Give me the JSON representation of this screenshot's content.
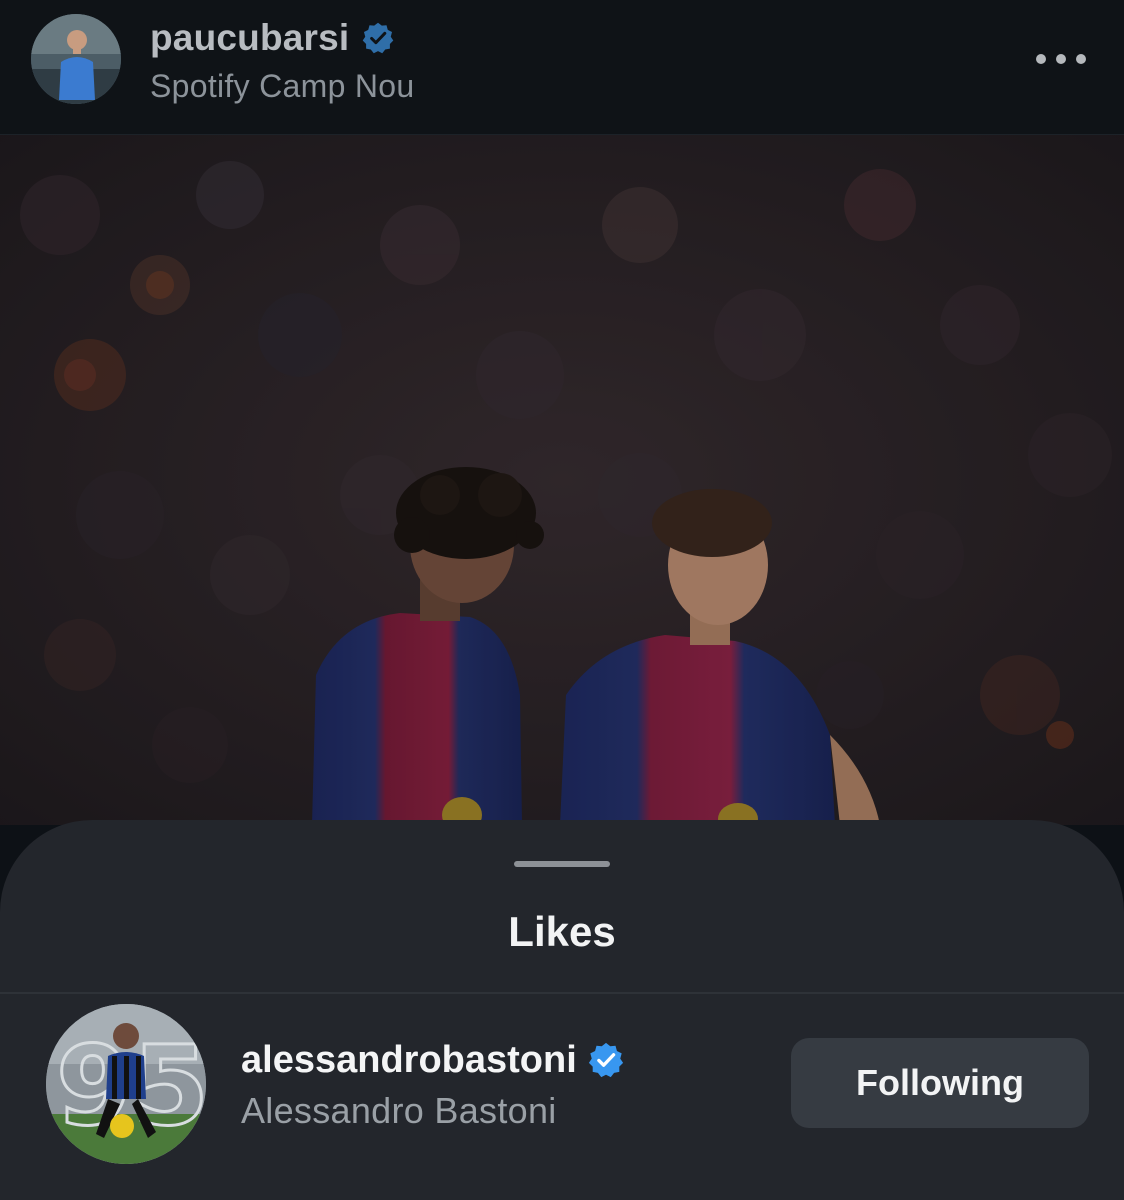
{
  "post": {
    "username": "paucubarsi",
    "location": "Spotify Camp Nou",
    "avatar_icon": "profile-photo-player",
    "verified_icon": "verified-badge-icon",
    "more_icon": "more-horizontal-icon"
  },
  "likes_sheet": {
    "title": "Likes",
    "users": [
      {
        "username": "alessandrobastoni",
        "full_name": "Alessandro Bastoni",
        "verified": true,
        "button_label": "Following"
      }
    ]
  },
  "colors": {
    "background": "#0d1116",
    "sheet": "#23262c",
    "button": "#363b42",
    "verified": "#3897f0",
    "barca_blue": "#1d2b6e",
    "barca_red": "#9c1c3c"
  }
}
